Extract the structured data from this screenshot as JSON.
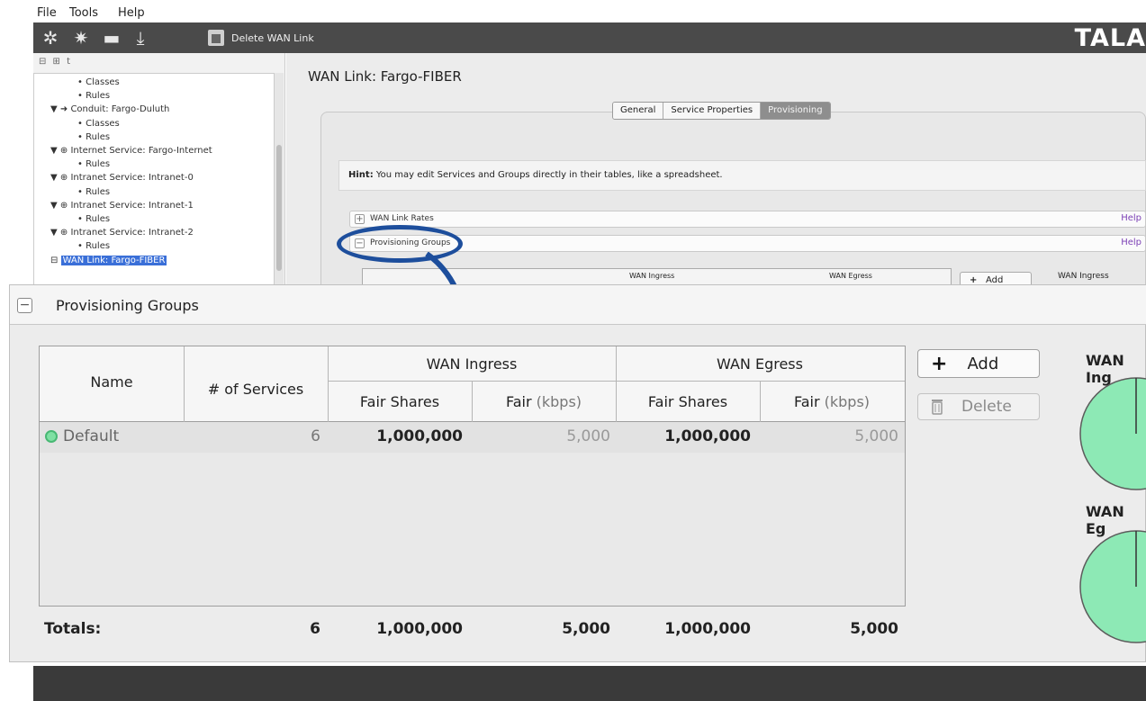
{
  "menu": {
    "file": "File",
    "tools": "Tools",
    "help": "Help"
  },
  "toolbar": {
    "icons": [
      "gear-icon",
      "gear-outline-icon",
      "folder-icon",
      "download-icon"
    ],
    "delete_label": "Delete WAN Link",
    "brand": "TALA"
  },
  "left_tools": "⊟ ⊞ t",
  "tree": [
    {
      "indent": 2,
      "prefix": "•",
      "label": "Classes"
    },
    {
      "indent": 2,
      "prefix": "•",
      "label": "Rules"
    },
    {
      "indent": 1,
      "prefix": "▼ ➜",
      "label": "Conduit: Fargo-Duluth"
    },
    {
      "indent": 2,
      "prefix": "•",
      "label": "Classes"
    },
    {
      "indent": 2,
      "prefix": "•",
      "label": "Rules"
    },
    {
      "indent": 1,
      "prefix": "▼ ⊕",
      "label": "Internet Service: Fargo-Internet"
    },
    {
      "indent": 2,
      "prefix": "•",
      "label": "Rules"
    },
    {
      "indent": 1,
      "prefix": "▼ ⊕",
      "label": "Intranet Service: Intranet-0"
    },
    {
      "indent": 2,
      "prefix": "•",
      "label": "Rules"
    },
    {
      "indent": 1,
      "prefix": "▼ ⊕",
      "label": "Intranet Service: Intranet-1"
    },
    {
      "indent": 2,
      "prefix": "•",
      "label": "Rules"
    },
    {
      "indent": 1,
      "prefix": "▼ ⊕",
      "label": "Intranet Service: Intranet-2"
    },
    {
      "indent": 2,
      "prefix": "•",
      "label": "Rules"
    },
    {
      "indent": 1,
      "prefix": "⊟",
      "label": "WAN Link: Fargo-FIBER",
      "selected": true
    }
  ],
  "wan_title": "WAN Link: Fargo-FIBER",
  "tabs": [
    {
      "label": "General",
      "active": false
    },
    {
      "label": "Service Properties",
      "active": false
    },
    {
      "label": "Provisioning",
      "active": true
    }
  ],
  "hint": {
    "bold": "Hint:",
    "text": " You may edit Services and Groups directly in their tables, like a spreadsheet."
  },
  "sections": {
    "rates": {
      "label": "WAN Link Rates",
      "help": "Help"
    },
    "groups": {
      "label": "Provisioning Groups",
      "help": "Help"
    }
  },
  "mini": {
    "ingress": "WAN Ingress",
    "egress": "WAN Egress",
    "add": "Add",
    "right_label": "WAN Ingress"
  },
  "zoom": {
    "title": "Provisioning Groups",
    "columns": {
      "name": "Name",
      "services": "# of Services",
      "ingress_group": "WAN Ingress",
      "egress_group": "WAN Egress",
      "fair_shares": "Fair Shares",
      "fair": "Fair",
      "kbps": "(kbps)"
    },
    "rows": [
      {
        "name": "Default",
        "services": "6",
        "ing_shares": "1,000,000",
        "ing_fair": "5,000",
        "eg_shares": "1,000,000",
        "eg_fair": "5,000"
      }
    ],
    "totals": {
      "label": "Totals:",
      "services": "6",
      "ing_shares": "1,000,000",
      "ing_fair": "5,000",
      "eg_shares": "1,000,000",
      "eg_fair": "5,000"
    },
    "buttons": {
      "add": "Add",
      "delete": "Delete"
    },
    "pies": {
      "ingress_label": "WAN Ing",
      "egress_label": "WAN Eg"
    }
  },
  "colors": {
    "pie": "#8de9b5",
    "status_dot": "#7fe0a3",
    "callout": "#1d4e9c",
    "help": "#7b3fb5",
    "selection": "#3a6fd8"
  }
}
